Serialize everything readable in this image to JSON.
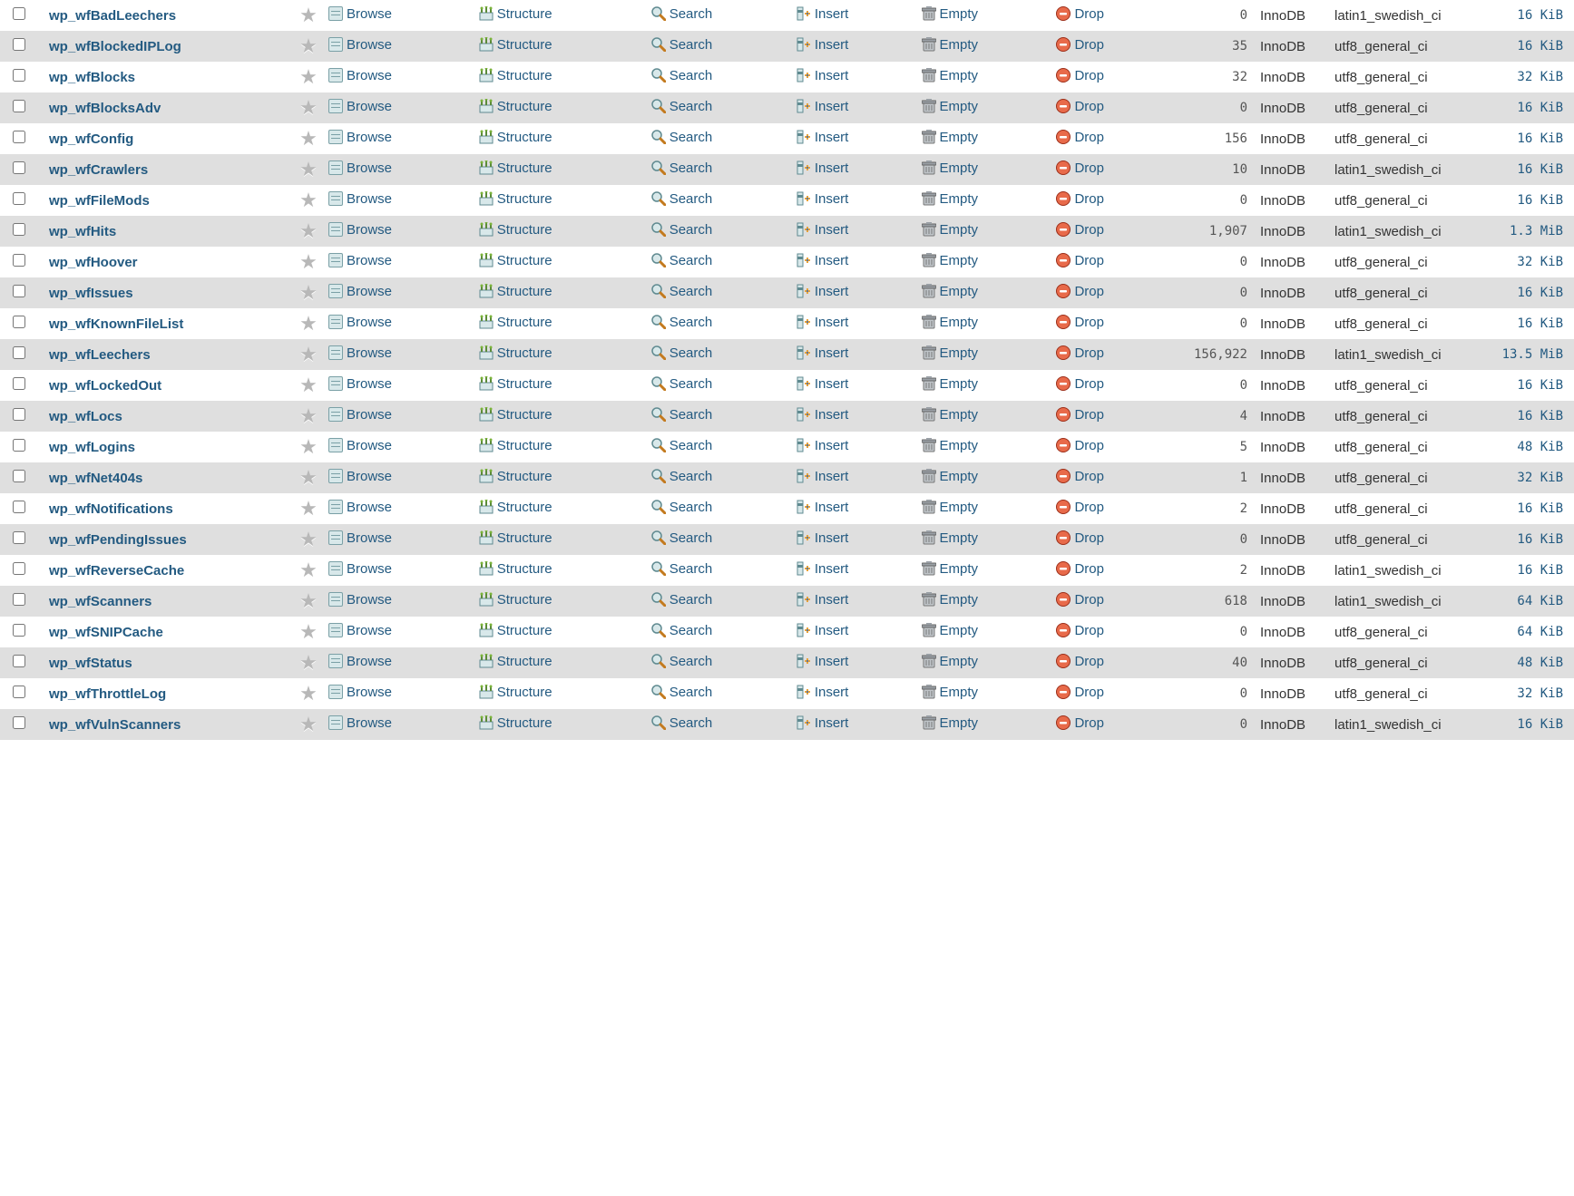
{
  "actions": {
    "browse": "Browse",
    "structure": "Structure",
    "search": "Search",
    "insert": "Insert",
    "empty": "Empty",
    "drop": "Drop"
  },
  "tables": [
    {
      "name": "wp_wfBadLeechers",
      "rows": "0",
      "engine": "InnoDB",
      "collation": "latin1_swedish_ci",
      "size": "16 KiB"
    },
    {
      "name": "wp_wfBlockedIPLog",
      "rows": "35",
      "engine": "InnoDB",
      "collation": "utf8_general_ci",
      "size": "16 KiB"
    },
    {
      "name": "wp_wfBlocks",
      "rows": "32",
      "engine": "InnoDB",
      "collation": "utf8_general_ci",
      "size": "32 KiB"
    },
    {
      "name": "wp_wfBlocksAdv",
      "rows": "0",
      "engine": "InnoDB",
      "collation": "utf8_general_ci",
      "size": "16 KiB"
    },
    {
      "name": "wp_wfConfig",
      "rows": "156",
      "engine": "InnoDB",
      "collation": "utf8_general_ci",
      "size": "16 KiB"
    },
    {
      "name": "wp_wfCrawlers",
      "rows": "10",
      "engine": "InnoDB",
      "collation": "latin1_swedish_ci",
      "size": "16 KiB"
    },
    {
      "name": "wp_wfFileMods",
      "rows": "0",
      "engine": "InnoDB",
      "collation": "utf8_general_ci",
      "size": "16 KiB"
    },
    {
      "name": "wp_wfHits",
      "rows": "1,907",
      "engine": "InnoDB",
      "collation": "latin1_swedish_ci",
      "size": "1.3 MiB"
    },
    {
      "name": "wp_wfHoover",
      "rows": "0",
      "engine": "InnoDB",
      "collation": "utf8_general_ci",
      "size": "32 KiB"
    },
    {
      "name": "wp_wfIssues",
      "rows": "0",
      "engine": "InnoDB",
      "collation": "utf8_general_ci",
      "size": "16 KiB"
    },
    {
      "name": "wp_wfKnownFileList",
      "rows": "0",
      "engine": "InnoDB",
      "collation": "utf8_general_ci",
      "size": "16 KiB"
    },
    {
      "name": "wp_wfLeechers",
      "rows": "156,922",
      "engine": "InnoDB",
      "collation": "latin1_swedish_ci",
      "size": "13.5 MiB"
    },
    {
      "name": "wp_wfLockedOut",
      "rows": "0",
      "engine": "InnoDB",
      "collation": "utf8_general_ci",
      "size": "16 KiB"
    },
    {
      "name": "wp_wfLocs",
      "rows": "4",
      "engine": "InnoDB",
      "collation": "utf8_general_ci",
      "size": "16 KiB"
    },
    {
      "name": "wp_wfLogins",
      "rows": "5",
      "engine": "InnoDB",
      "collation": "utf8_general_ci",
      "size": "48 KiB"
    },
    {
      "name": "wp_wfNet404s",
      "rows": "1",
      "engine": "InnoDB",
      "collation": "utf8_general_ci",
      "size": "32 KiB"
    },
    {
      "name": "wp_wfNotifications",
      "rows": "2",
      "engine": "InnoDB",
      "collation": "utf8_general_ci",
      "size": "16 KiB"
    },
    {
      "name": "wp_wfPendingIssues",
      "rows": "0",
      "engine": "InnoDB",
      "collation": "utf8_general_ci",
      "size": "16 KiB"
    },
    {
      "name": "wp_wfReverseCache",
      "rows": "2",
      "engine": "InnoDB",
      "collation": "latin1_swedish_ci",
      "size": "16 KiB"
    },
    {
      "name": "wp_wfScanners",
      "rows": "618",
      "engine": "InnoDB",
      "collation": "latin1_swedish_ci",
      "size": "64 KiB"
    },
    {
      "name": "wp_wfSNIPCache",
      "rows": "0",
      "engine": "InnoDB",
      "collation": "utf8_general_ci",
      "size": "64 KiB"
    },
    {
      "name": "wp_wfStatus",
      "rows": "40",
      "engine": "InnoDB",
      "collation": "utf8_general_ci",
      "size": "48 KiB"
    },
    {
      "name": "wp_wfThrottleLog",
      "rows": "0",
      "engine": "InnoDB",
      "collation": "utf8_general_ci",
      "size": "32 KiB"
    },
    {
      "name": "wp_wfVulnScanners",
      "rows": "0",
      "engine": "InnoDB",
      "collation": "latin1_swedish_ci",
      "size": "16 KiB"
    }
  ]
}
